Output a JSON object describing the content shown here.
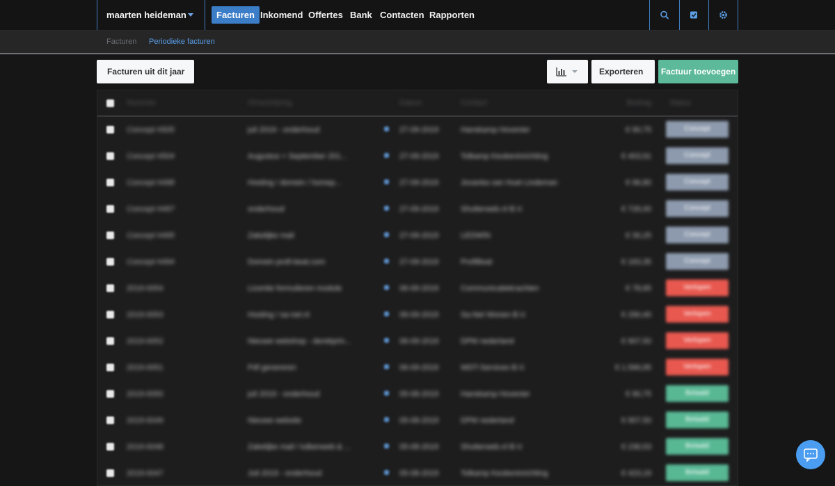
{
  "topbar": {
    "account": "maarten heideman",
    "nav": [
      {
        "label": "Facturen",
        "active": true
      },
      {
        "label": "Inkomend",
        "active": false
      },
      {
        "label": "Offertes",
        "active": false
      },
      {
        "label": "Bank",
        "active": false
      },
      {
        "label": "Contacten",
        "active": false
      },
      {
        "label": "Rapporten",
        "active": false
      }
    ],
    "icons": [
      "search-icon",
      "checkbox-icon",
      "gear-icon"
    ]
  },
  "subnav": {
    "items": [
      {
        "label": "Facturen",
        "active": false
      },
      {
        "label": "Periodieke facturen",
        "active": true
      }
    ]
  },
  "toolbar": {
    "filter_label": "Facturen uit dit jaar",
    "chart_icon": "bar-chart-icon",
    "export_label": "Exporteren",
    "add_label": "Factuur toevoegen"
  },
  "table": {
    "headers": [
      "Nummer",
      "Omschrijving",
      "Datum",
      "Contact",
      "Bedrag",
      "Status"
    ],
    "rows": [
      {
        "nummer": "Concept #505",
        "omschrijving": "juli 2019 - onderhoud",
        "datum": "27-09-2019",
        "contact": "Hanskamp Hovenier",
        "bedrag": "€ 90,75",
        "status": "Concept"
      },
      {
        "nummer": "Concept #504",
        "omschrijving": "Augustus + September 201...",
        "datum": "27-09-2019",
        "contact": "Tolkamp Keukeninrichting",
        "bedrag": "€ 403,91",
        "status": "Concept"
      },
      {
        "nummer": "Concept #498",
        "omschrijving": "Hosting / domein / homep...",
        "datum": "27-09-2019",
        "contact": "Jovanka van Huet Lindeman",
        "bedrag": "€ 96,80",
        "status": "Concept"
      },
      {
        "nummer": "Concept #497",
        "omschrijving": "onderhoud",
        "datum": "27-09-2019",
        "contact": "Shutterweb.nl B.V.",
        "bedrag": "€ 726,00",
        "status": "Concept"
      },
      {
        "nummer": "Concept #495",
        "omschrijving": "Zakelijke mail",
        "datum": "27-09-2019",
        "contact": "LEDWIN",
        "bedrag": "€ 30,25",
        "status": "Concept"
      },
      {
        "nummer": "Concept #494",
        "omschrijving": "Domein profi-beat.com",
        "datum": "27-09-2019",
        "contact": "ProfiBeat",
        "bedrag": "€ 163,35",
        "status": "Concept"
      },
      {
        "nummer": "2019-0054",
        "omschrijving": "Licentie formulieren module",
        "datum": "06-09-2019",
        "contact": "Communicatiekrachten",
        "bedrag": "€ 78,65",
        "status": "Verlopen"
      },
      {
        "nummer": "2019-0053",
        "omschrijving": "Hosting / sa-net.nl",
        "datum": "06-09-2019",
        "contact": "Sa-Net Wonen B.V.",
        "bedrag": "€ 290,40",
        "status": "Verlopen"
      },
      {
        "nummer": "2019-0052",
        "omschrijving": "Nieuwe webshop - derekprin...",
        "datum": "06-09-2019",
        "contact": "DPM nederland",
        "bedrag": "€ 907,50",
        "status": "Verlopen"
      },
      {
        "nummer": "2019-0051",
        "omschrijving": "Pdf genereren",
        "datum": "06-09-2019",
        "contact": "WDT-Services B.V.",
        "bedrag": "€ 1.566,95",
        "status": "Verlopen"
      },
      {
        "nummer": "2019-0050",
        "omschrijving": "juli 2019 - onderhoud",
        "datum": "05-08-2019",
        "contact": "Hanskamp Hovenier",
        "bedrag": "€ 90,75",
        "status": "Betaald"
      },
      {
        "nummer": "2019-0049",
        "omschrijving": "Nieuwe website",
        "datum": "05-08-2019",
        "contact": "DPM nederland",
        "bedrag": "€ 907,50",
        "status": "Betaald"
      },
      {
        "nummer": "2019-0048",
        "omschrijving": "Zakelijke mail / tulkenweb & ...",
        "datum": "05-08-2019",
        "contact": "Shutterweb.nl B.V.",
        "bedrag": "€ 236,53",
        "status": "Betaald"
      },
      {
        "nummer": "2019-0047",
        "omschrijving": "Juli 2019 - onderhoud",
        "datum": "05-08-2019",
        "contact": "Tolkamp Keukeninrichting",
        "bedrag": "€ 423,19",
        "status": "Betaald"
      }
    ]
  },
  "status_colors": {
    "Concept": "#8d9aad",
    "Verlopen": "#e8584f",
    "Betaald": "#58b894"
  },
  "chat_icon": "chat-bubble-icon"
}
